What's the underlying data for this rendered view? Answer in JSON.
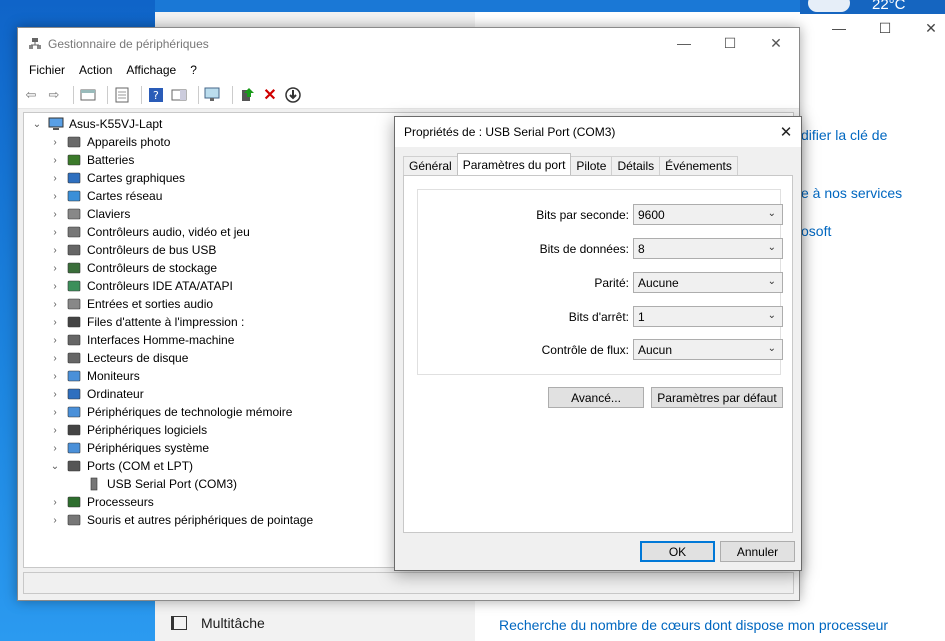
{
  "background": {
    "temperature": "22°C",
    "links": [
      "difier la clé de",
      "e à nos services",
      "osoft",
      "Recherche du nombre de cœurs dont dispose mon processeur"
    ],
    "bottom_nav_label": "Multitâche"
  },
  "device_manager": {
    "title": "Gestionnaire de périphériques",
    "menu": [
      "Fichier",
      "Action",
      "Affichage",
      "?"
    ],
    "tree": {
      "root": "Asus-K55VJ-Lapt",
      "categories": [
        "Appareils photo",
        "Batteries",
        "Cartes graphiques",
        "Cartes réseau",
        "Claviers",
        "Contrôleurs audio, vidéo et jeu",
        "Contrôleurs de bus USB",
        "Contrôleurs de stockage",
        "Contrôleurs IDE ATA/ATAPI",
        "Entrées et sorties audio",
        "Files d'attente à l'impression :",
        "Interfaces Homme-machine",
        "Lecteurs de disque",
        "Moniteurs",
        "Ordinateur",
        "Périphériques de technologie mémoire",
        "Périphériques logiciels",
        "Périphériques système",
        "Ports (COM et LPT)",
        "Processeurs",
        "Souris et autres périphériques de pointage"
      ],
      "expanded_child": "USB Serial Port (COM3)"
    }
  },
  "dialog": {
    "title": "Propriétés de : USB Serial Port (COM3)",
    "tabs": [
      "Général",
      "Paramètres du port",
      "Pilote",
      "Détails",
      "Événements"
    ],
    "active_tab": "Paramètres du port",
    "fields": [
      {
        "label": "Bits par seconde:",
        "value": "9600"
      },
      {
        "label": "Bits de données:",
        "value": "8"
      },
      {
        "label": "Parité:",
        "value": "Aucune"
      },
      {
        "label": "Bits d'arrêt:",
        "value": "1"
      },
      {
        "label": "Contrôle de flux:",
        "value": "Aucun"
      }
    ],
    "buttons": {
      "advanced": "Avancé...",
      "defaults": "Paramètres par défaut",
      "ok": "OK",
      "cancel": "Annuler"
    }
  }
}
